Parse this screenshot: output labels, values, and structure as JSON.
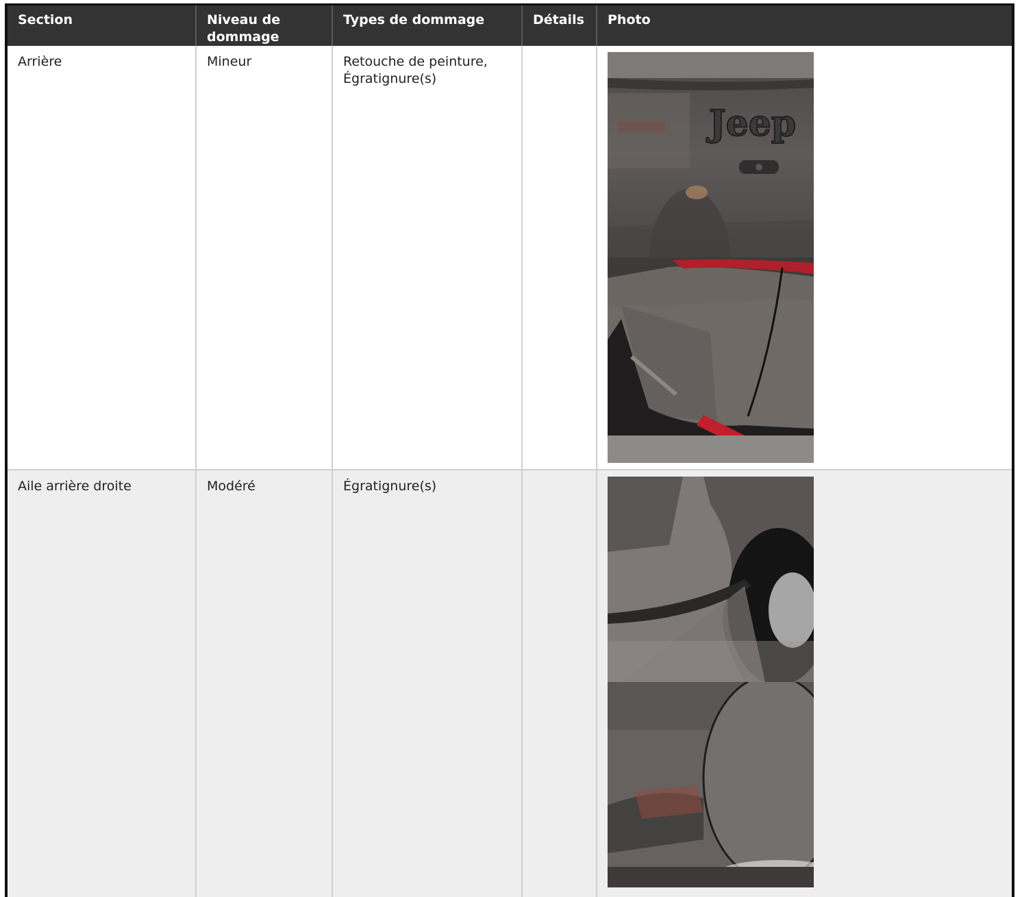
{
  "table": {
    "headers": [
      "Section",
      "Niveau de dommage",
      "Types de dommage",
      "Détails",
      "Photo"
    ],
    "rows": [
      {
        "section": "Arrière",
        "level": "Mineur",
        "types": "Retouche de peinture, Égratignure(s)",
        "details": "",
        "photos": [
          "rear-tailgate-jeep-badge-photo",
          "rear-bumper-scratch-photo"
        ]
      },
      {
        "section": "Aile arrière droite",
        "level": "Modéré",
        "types": "Égratignure(s)",
        "details": "",
        "photos": [
          "rear-fender-wheel-photo",
          "fuel-door-panel-photo"
        ]
      }
    ]
  },
  "badge_text": "Jeep",
  "colors": {
    "header_bg": "#333333",
    "header_text": "#ffffff",
    "row_alt_bg": "#eeeeee",
    "vehicle_paint": "#5e5956"
  }
}
